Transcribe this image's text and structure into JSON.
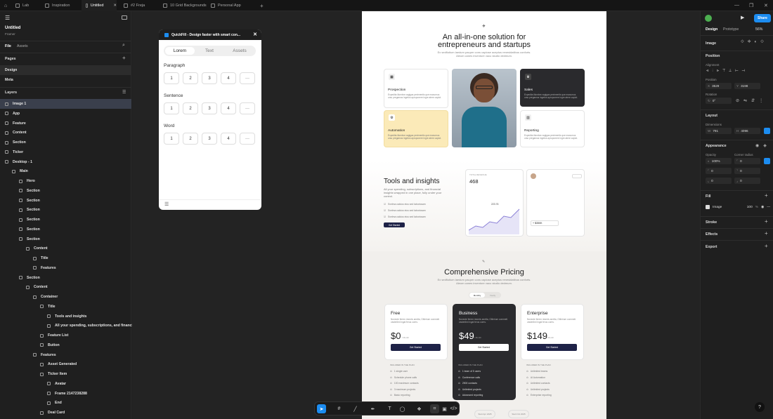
{
  "tabs": [
    {
      "label": "Lab"
    },
    {
      "label": "Inspiration"
    },
    {
      "label": "Untitled"
    },
    {
      "label": "#2 Freja"
    },
    {
      "label": "10 Grid Backgrounds"
    },
    {
      "label": "Personal App"
    }
  ],
  "project": {
    "name": "Untitled",
    "org": "Framer"
  },
  "left_tabs": {
    "file": "File",
    "assets": "Assets"
  },
  "pages": {
    "heading": "Pages",
    "items": [
      "Design",
      "Meta"
    ]
  },
  "layers": {
    "heading": "Layers",
    "items": [
      "Image 1",
      "App",
      "Feature",
      "Content",
      "Section",
      "Ticker",
      "Desktop - 1",
      "Main",
      "Hero",
      "Section",
      "Section",
      "Section",
      "Section",
      "Section",
      "Section",
      "Content",
      "Title",
      "Features",
      "Section",
      "Content",
      "Container",
      "Title",
      "Tools and insights",
      "All your spending, subscriptions, and financial i...",
      "Feature List",
      "Button",
      "Features",
      "Asset Generated",
      "Ticker Item",
      "Avatar",
      "Frame 2147238288",
      "End",
      "Deal Card"
    ]
  },
  "plugin": {
    "title": "QuickFill - Design faster with smart con...",
    "segments": [
      "Lorem",
      "Text",
      "Assets"
    ],
    "groups": [
      "Paragraph",
      "Sentence",
      "Word"
    ],
    "options": [
      "1",
      "2",
      "3",
      "4",
      "···"
    ]
  },
  "site": {
    "hero_title_1": "An all-in-one solution for",
    "hero_title_2": "entrepreneurs and startups",
    "hero_sub": "Ex sedfiotium laedum pauper cons capiose aceptus renesidatibus conforts. Aleum canes inventore vacu studio dedmum.",
    "cards": [
      {
        "title": "Prospection",
        "text": "Expedita illumbra vagigas peximentis que maxumus urso pregamus ingetos aproponere ingre atere capiot."
      },
      {
        "title": "Sales",
        "text": "Expedita illumbra vagigas peximentis que maxumus urso pregamus ingetos aproponere ingre atere capiot."
      },
      {
        "title": "Automation",
        "text": "Expedita illumbra vagigas peximentis que maxumus urso pregamus ingetos aproponere ingre atere capiot."
      },
      {
        "title": "Reporting",
        "text": "Expedita illumbra vagigas peximentis que maxumus urso pregamus ingetos aproponere ingre atere capiot."
      }
    ],
    "tools_title": "Tools and insights",
    "tools_sub": "All your spending, subscriptions, and financial insights wrapped in one place, fully under your control.",
    "tools_list": [
      "Svelma calcius eius sed laboriosam",
      "Svelma calcius eius sed laboriosam",
      "Svelma calcius eius sed laboriosam"
    ],
    "tools_button": "Get Started",
    "stat_label": "TOTAL REVENUE",
    "stat_value": "468",
    "stat_value2": "223.76",
    "deal_amount": "+ $350K",
    "pricing_title": "Comprehensive Pricing",
    "pricing_sub": "Ex sedfiotium laedum pauper cons capiose aceptus renesidatibus conforts. Aleum canes inventore vacu studio dedmum.",
    "billing": [
      "Monthly",
      "Yearly"
    ],
    "plans": [
      {
        "name": "Free",
        "price": "$0",
        "period": "/ Month",
        "button": "Get Started",
        "desc": "Nonecte ferem resevis anetta, Gitlerium commeti vasterlimi ingat ferus cores.",
        "features": [
          "1 single user",
          "Schedule phone calls",
          "100 maximum contacts",
          "3 maximum projects",
          "Basic reporting"
        ]
      },
      {
        "name": "Business",
        "price": "$49",
        "period": "/ Month",
        "button": "Get Started",
        "desc": "Nonecte ferem resevis anetta, Gitlerium commeti vasterlimi ingat ferus cores.",
        "features": [
          "1 team of 5 users",
          "Conference calls",
          "2500 contacts",
          "Unlimited projects",
          "Advanced reporting"
        ]
      },
      {
        "name": "Enterprise",
        "price": "$149",
        "period": "/ Month",
        "button": "Get Started",
        "desc": "Nonecte ferem resevis anetta, Gitlerium commeti vasterlimi ingat ferus cores.",
        "features": [
          "Unlimited teams",
          "AI Automation",
          "Unlimited contacts",
          "Unlimited projects",
          "Enterprise reporting"
        ]
      }
    ],
    "included": "INCLUDED IN THE PLAN",
    "ticker": [
      "Start Apr 2025",
      "Start Oct 2025"
    ]
  },
  "right": {
    "tabs": [
      "Design",
      "Prototype"
    ],
    "zoom": "56%",
    "share": "Share",
    "section_title": "Image",
    "position_heading": "Position",
    "alignment": "Alignment",
    "position_label": "Position",
    "x": "3529",
    "y": "3198",
    "rotation_label": "Rotation",
    "rotation": "0°",
    "layout_heading": "Layout",
    "dimensions_label": "Dimensions",
    "w": "791",
    "h": "4096",
    "appearance_heading": "Appearance",
    "opacity_label": "Opacity",
    "opacity": "100%",
    "radius_label": "Corner radius",
    "radius": [
      "0",
      "0",
      "0",
      "0",
      "0"
    ],
    "fill_heading": "Fill",
    "fill_type": "Image",
    "fill_opacity": "100",
    "fill_unit": "%",
    "stroke_heading": "Stroke",
    "effects_heading": "Effects",
    "export_heading": "Export"
  },
  "colors": {
    "accent": "#1c8cf0",
    "selection": "#3a3f4c",
    "navy": "#1e2247",
    "cream": "#fbeab8",
    "dark_card": "#2a2a2d"
  }
}
